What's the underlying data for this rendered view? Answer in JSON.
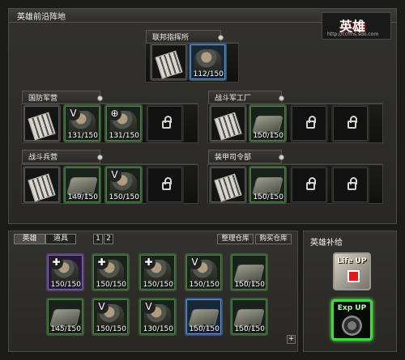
{
  "header": {
    "title": "英雄前沿阵地",
    "logo": {
      "name": "英雄",
      "url": "http://ccfms.sdo.com"
    }
  },
  "sections": {
    "hq": {
      "label": "联邦指挥所",
      "slots": [
        {
          "type": "building"
        },
        {
          "type": "unit",
          "color": "blue",
          "count": "112/150"
        }
      ]
    },
    "barracks": {
      "label": "国防军营",
      "slots": [
        {
          "type": "building"
        },
        {
          "type": "unit",
          "color": "green",
          "icon": "sergeant-chevron-icon",
          "count": "131/150"
        },
        {
          "type": "unit",
          "color": "green",
          "icon": "crosshair-icon",
          "count": "131/150"
        },
        {
          "type": "locked"
        }
      ]
    },
    "factory": {
      "label": "战斗军工厂",
      "slots": [
        {
          "type": "building"
        },
        {
          "type": "vehicle",
          "color": "green",
          "count": "150/150"
        },
        {
          "type": "locked"
        },
        {
          "type": "locked"
        }
      ]
    },
    "infantry": {
      "label": "战斗兵营",
      "slots": [
        {
          "type": "building"
        },
        {
          "type": "vehicle",
          "color": "green",
          "count": "149/150"
        },
        {
          "type": "unit",
          "color": "green",
          "icon": "sergeant-chevron-icon",
          "count": "150/150"
        },
        {
          "type": "locked"
        }
      ]
    },
    "armor_hq": {
      "label": "装甲司令部",
      "slots": [
        {
          "type": "building"
        },
        {
          "type": "vehicle",
          "color": "green",
          "count": "150/150"
        },
        {
          "type": "locked"
        },
        {
          "type": "locked"
        }
      ]
    }
  },
  "inventory": {
    "tabs": [
      "英雄",
      "道具"
    ],
    "pages": [
      "1",
      "2"
    ],
    "buttons": {
      "arrange": "整理仓库",
      "buy": "购买仓库"
    },
    "items": [
      {
        "type": "unit",
        "color": "purple",
        "icon": "wrench-icon",
        "count": "150/150"
      },
      {
        "type": "unit",
        "color": "green",
        "icon": "wrench-icon",
        "count": "150/150"
      },
      {
        "type": "unit",
        "color": "green",
        "icon": "wrench-icon",
        "count": "150/150"
      },
      {
        "type": "unit",
        "color": "green",
        "icon": "sergeant-chevron-icon",
        "count": "150/150"
      },
      {
        "type": "vehicle",
        "color": "green",
        "count": "150/150"
      },
      {
        "type": "vehicle",
        "color": "green",
        "count": "145/150"
      },
      {
        "type": "unit",
        "color": "green",
        "icon": "sergeant-chevron-icon",
        "count": "150/150"
      },
      {
        "type": "unit",
        "color": "green",
        "icon": "sergeant-chevron-icon",
        "count": "130/150"
      },
      {
        "type": "vehicle",
        "color": "blue",
        "count": "150/150"
      },
      {
        "type": "vehicle",
        "color": "green",
        "count": "150/150"
      }
    ]
  },
  "supply": {
    "title": "英雄补给",
    "life_label": "Life UP",
    "exp_label": "Exp UP"
  }
}
